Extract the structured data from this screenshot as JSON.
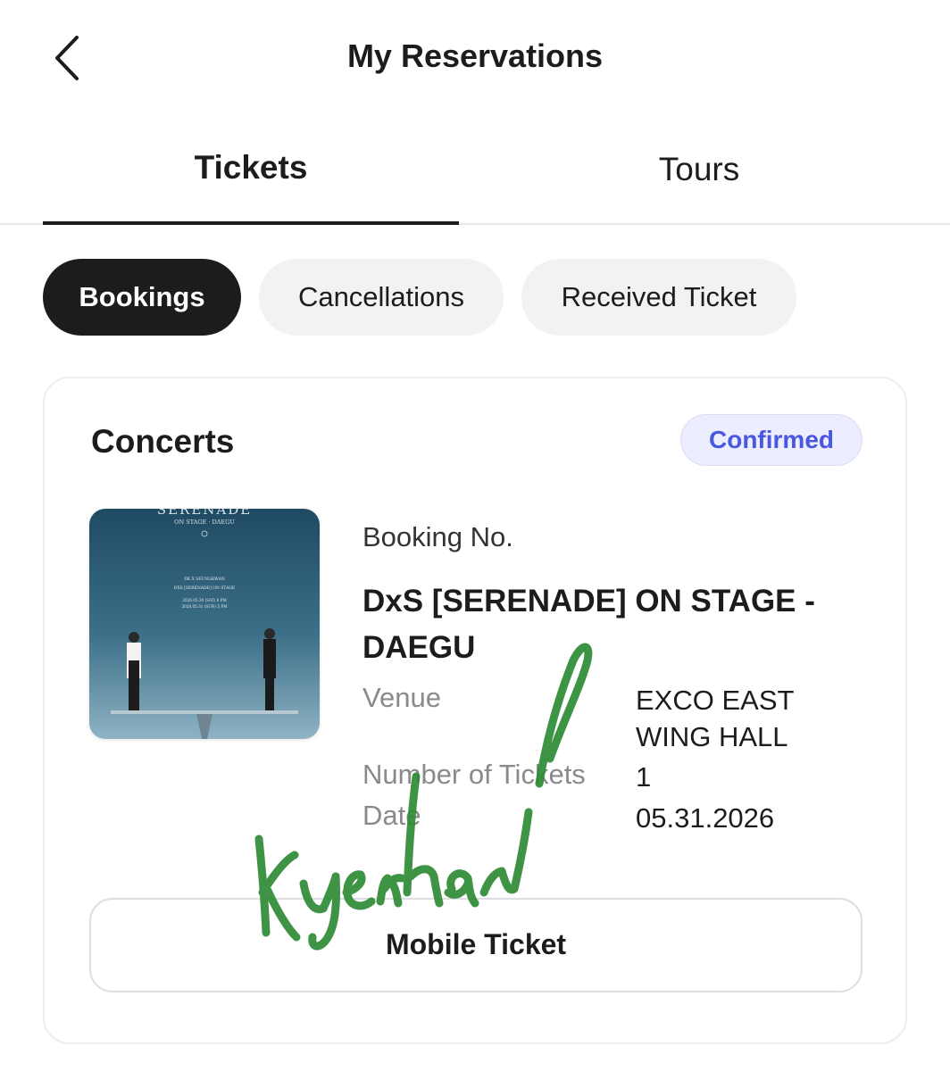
{
  "header": {
    "title": "My Reservations",
    "back_icon": "chevron-left-icon"
  },
  "tabs": [
    {
      "label": "Tickets",
      "active": true
    },
    {
      "label": "Tours",
      "active": false
    }
  ],
  "filters": [
    {
      "label": "Bookings",
      "active": true
    },
    {
      "label": "Cancellations",
      "active": false
    },
    {
      "label": "Received Ticket",
      "active": false
    }
  ],
  "reservation": {
    "category": "Concerts",
    "status": "Confirmed",
    "booking_no_label": "Booking No.",
    "event_title": "DxS [SERENADE] ON STAGE - DAEGU",
    "details": [
      {
        "label": "Venue",
        "value": "EXCO EAST WING HALL"
      },
      {
        "label": "Number of Tickets",
        "value": "1"
      },
      {
        "label": "Date",
        "value": "05.31.2026"
      }
    ],
    "action_label": "Mobile Ticket",
    "poster": {
      "heading": "SERENADE",
      "subheading": "ON STAGE · DAEGU",
      "line1": "DK X SEUNGKWAN",
      "line2": "DXS [SERENADE] ON STAGE",
      "line3": "2026.05.30 (SAT) 6 PM",
      "line4": "2026.05.31 (SUN) 5 PM"
    },
    "watermark_signature": "kyeonhaul"
  },
  "colors": {
    "accent": "#4a57e0",
    "badge_bg": "#eceeff",
    "chip_active": "#1c1c1e",
    "chip_inactive": "#f2f2f4",
    "signature": "#2e8b35"
  }
}
